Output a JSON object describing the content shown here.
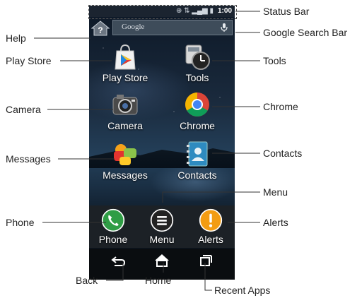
{
  "status_bar": {
    "time": "1:00"
  },
  "search": {
    "placeholder": "Google"
  },
  "apps": [
    {
      "label": "Play Store"
    },
    {
      "label": "Tools"
    },
    {
      "label": "Camera"
    },
    {
      "label": "Chrome"
    },
    {
      "label": "Messages"
    },
    {
      "label": "Contacts"
    }
  ],
  "dock": [
    {
      "label": "Phone"
    },
    {
      "label": "Menu"
    },
    {
      "label": "Alerts"
    }
  ],
  "callouts": {
    "status_bar": "Status Bar",
    "help": "Help",
    "google_search_bar": "Google Search Bar",
    "play_store": "Play Store",
    "tools": "Tools",
    "camera": "Camera",
    "chrome": "Chrome",
    "messages": "Messages",
    "contacts": "Contacts",
    "menu": "Menu",
    "phone": "Phone",
    "alerts": "Alerts",
    "back": "Back",
    "home": "Home",
    "recent_apps": "Recent Apps"
  }
}
